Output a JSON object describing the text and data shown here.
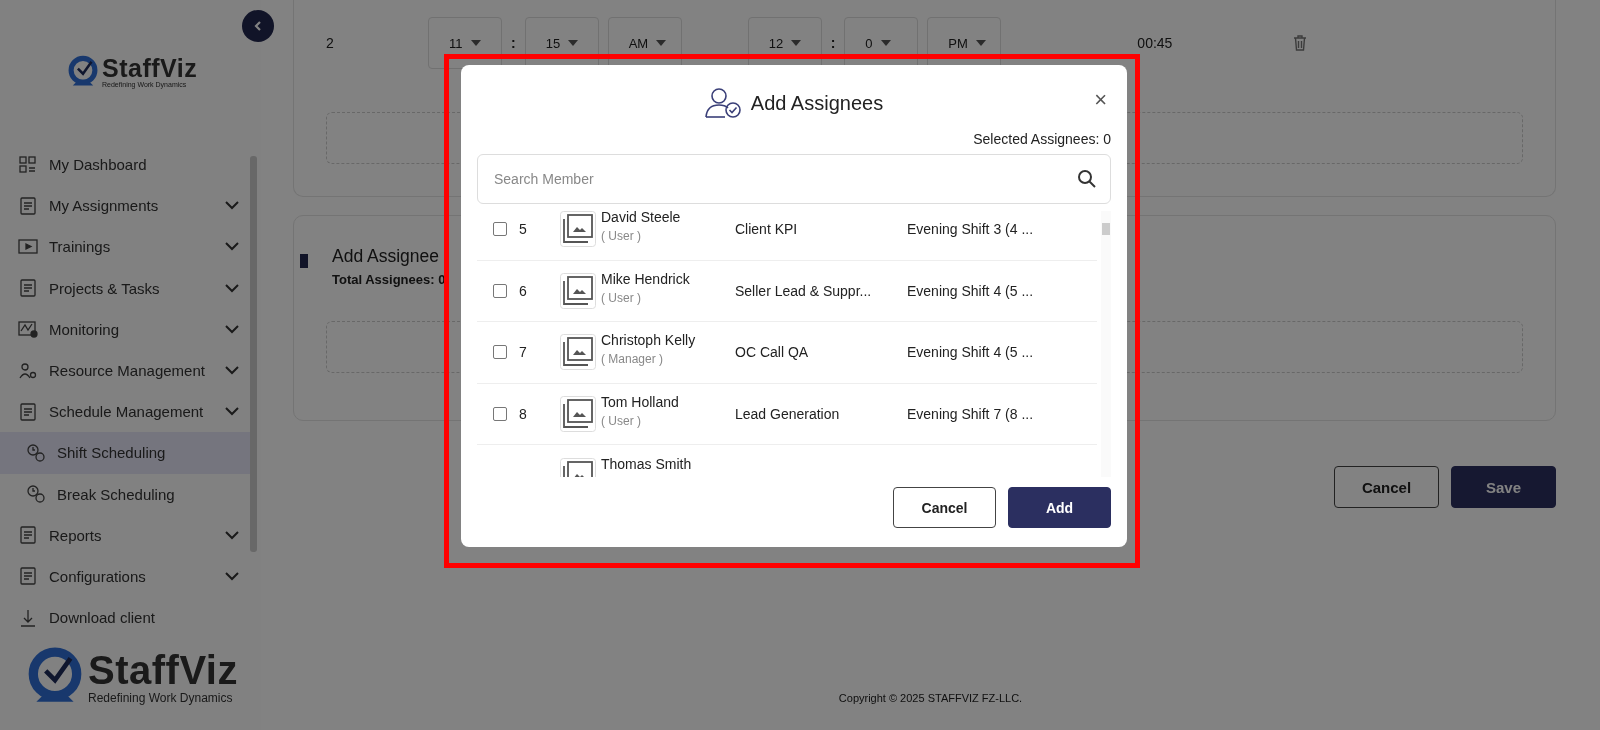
{
  "sidebar": {
    "logo": {
      "name": "StaffViz",
      "tagline": "Redefining Work Dynamics"
    },
    "items": [
      {
        "label": "My Dashboard",
        "expandable": false,
        "selected": false
      },
      {
        "label": "My Assignments",
        "expandable": true,
        "selected": false
      },
      {
        "label": "Trainings",
        "expandable": true,
        "selected": false
      },
      {
        "label": "Projects & Tasks",
        "expandable": true,
        "selected": false
      },
      {
        "label": "Monitoring",
        "expandable": true,
        "selected": false
      },
      {
        "label": "Resource Management",
        "expandable": true,
        "selected": false
      },
      {
        "label": "Schedule Management",
        "expandable": true,
        "selected": false,
        "children": [
          {
            "label": "Shift Scheduling",
            "selected": true
          },
          {
            "label": "Break Scheduling",
            "selected": false
          }
        ]
      },
      {
        "label": "Reports",
        "expandable": true,
        "selected": false
      },
      {
        "label": "Configurations",
        "expandable": true,
        "selected": false
      },
      {
        "label": "Download client",
        "expandable": false,
        "selected": false
      }
    ],
    "footer_logo": {
      "name": "StaffViz",
      "tagline": "Redefining Work Dynamics"
    }
  },
  "time_slot": {
    "index": "2",
    "start": {
      "hour": "11",
      "separator": ":",
      "minute": "15",
      "period": "AM"
    },
    "end": {
      "hour": "12",
      "separator": ":",
      "minute": "0",
      "period": "PM"
    },
    "duration": "00:45"
  },
  "assignees_section": {
    "title": "Add Assignee",
    "total_label": "Total Assignees: 0"
  },
  "buttons": [
    {
      "label": "Cancel",
      "kind": "secondary"
    },
    {
      "label": "Save",
      "kind": "primary"
    }
  ],
  "copyright": "Copyright © 2025 STAFFVIZ FZ-LLC.",
  "modal": {
    "title": "Add Assignees",
    "close": "×",
    "selected_count": "Selected Assignees: 0",
    "search": {
      "placeholder": "Search Member"
    },
    "rows": [
      {
        "checked": false,
        "number": "5",
        "name": "David Steele",
        "role": "( User )",
        "team": "Client KPI",
        "shift": "Evening Shift 3 (4 ..."
      },
      {
        "checked": false,
        "number": "6",
        "name": "Mike Hendrick",
        "role": "( User )",
        "team": "Seller Lead & Suppr...",
        "shift": "Evening Shift 4 (5 ..."
      },
      {
        "checked": false,
        "number": "7",
        "name": "Christoph Kelly",
        "role": "( Manager )",
        "team": "OC Call QA",
        "shift": "Evening Shift 4 (5 ..."
      },
      {
        "checked": false,
        "number": "8",
        "name": "Tom Holland",
        "role": "( User )",
        "team": "Lead Generation",
        "shift": "Evening Shift 7 (8 ..."
      },
      {
        "name": "Thomas Smith"
      }
    ],
    "buttons": [
      {
        "label": "Cancel",
        "kind": "secondary"
      },
      {
        "label": "Add",
        "kind": "primary"
      }
    ]
  }
}
